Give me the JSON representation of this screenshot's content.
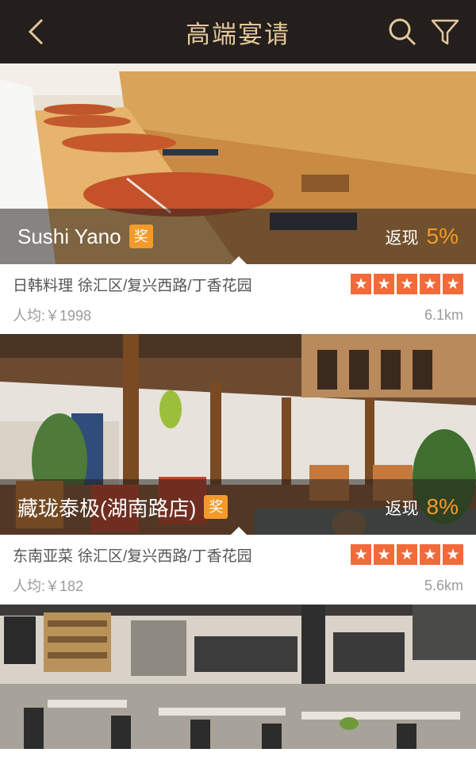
{
  "header": {
    "title": "高端宴请"
  },
  "restaurants": [
    {
      "name": "Sushi Yano",
      "badge": "奖",
      "cashback_label": "返现",
      "cashback_pct": "5%",
      "cuisine": "日韩料理",
      "area": "徐汇区/复兴西路/丁香花园",
      "rating": 5,
      "avg_price": "人均:￥1998",
      "distance": "6.1km"
    },
    {
      "name": "藏珑泰极(湖南路店)",
      "badge": "奖",
      "cashback_label": "返现",
      "cashback_pct": "8%",
      "cuisine": "东南亚菜",
      "area": "徐汇区/复兴西路/丁香花园",
      "rating": 5,
      "avg_price": "人均:￥182",
      "distance": "5.6km"
    }
  ],
  "colors": {
    "header_bg": "#241f1c",
    "title": "#e2c79a",
    "accent": "#f39a2b",
    "star": "#f36a3a"
  }
}
